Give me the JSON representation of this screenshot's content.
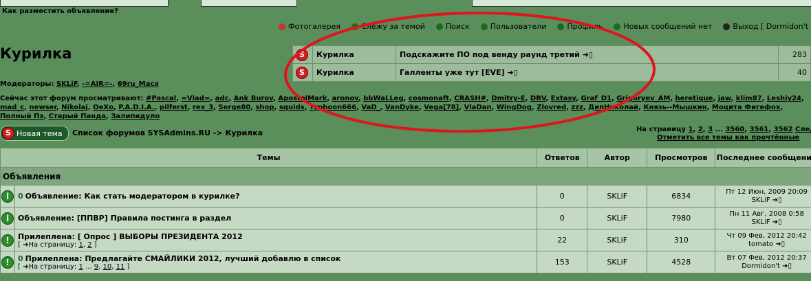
{
  "header": {
    "how_to_post": "Как разместить объявление?",
    "nav": [
      {
        "icon": "gallery-icon",
        "label": "Фотогалерея",
        "color": "#c0392b"
      },
      {
        "icon": "watch-icon",
        "label": "Слежу за темой",
        "color": "#1a6b1a"
      },
      {
        "icon": "search-icon",
        "label": "Поиск",
        "color": "#1a6b1a"
      },
      {
        "icon": "users-icon",
        "label": "Пользователи",
        "color": "#1a6b1a"
      },
      {
        "icon": "profile-icon",
        "label": "Профиль",
        "color": "#1a6b1a"
      },
      {
        "icon": "messages-icon",
        "label": "Новых сообщений нет",
        "color": "#1a6b1a"
      },
      {
        "icon": "logout-icon",
        "label": "Выход [ Dormidon't",
        "color": "#222222"
      }
    ]
  },
  "forum": {
    "title": "Курилка",
    "moderators_label": "Модераторы:",
    "moderators": [
      "SKLiF",
      "-=AIR=-",
      "69ru_Мася"
    ],
    "viewers_label": "Сейчас этот форум просматривают:",
    "viewers": [
      "#Pascal",
      "=Vlad=",
      "adc",
      "Ank Burov",
      "ApostolMark",
      "aronov",
      "bbWaLLeg",
      "cosmonaft",
      "CRASH#",
      "Dmitry-E",
      "DRV",
      "Extasy",
      "Graf_D1",
      "Grigoryev_AM",
      "heretique",
      "jaw",
      "klim87",
      "Leshiy24",
      "mad_c",
      "newser",
      "Nikolaj",
      "OeXo",
      "P.A.D.I.A.",
      "pilferst",
      "rex_3",
      "Serge80",
      "shop",
      "squids",
      "Typhoon666",
      "VaD_",
      "VanDyke",
      "Vega[78]",
      "VlaDan",
      "WingDog",
      "Zlovred",
      "zzz",
      "ДипНиколай",
      "Князь--Мышкин",
      "Моцита Фигефох",
      "Полный Пэ",
      "Старый Панда",
      "Залипидуло"
    ]
  },
  "popular": [
    {
      "forum": "Курилка",
      "topic": "Подскажите ПО под венду раунд третий",
      "count": "283"
    },
    {
      "forum": "Курилка",
      "topic": "Галленты уже тут [EVE]",
      "count": "40"
    }
  ],
  "toolbar": {
    "new_topic_label": "Новая тема",
    "breadcrumb": "Список форумов SYSAdmins.RU -> Курилка",
    "pager_label": "На страницу",
    "pages": [
      "1",
      "2",
      "3",
      "...",
      "3560",
      "3561",
      "3562"
    ],
    "next_label": "След.",
    "mark_read": "Отметить все темы как прочтённые"
  },
  "table": {
    "headers": {
      "topics": "Темы",
      "replies": "Ответов",
      "author": "Автор",
      "views": "Просмотров",
      "last": "Последнее сообщение"
    },
    "section": "Объявления",
    "rows": [
      {
        "prefix": "Объявление:",
        "title": "Как стать модератором в курилке?",
        "attachment": true,
        "pages_label": "",
        "pages": [],
        "replies": "0",
        "author": "SKLiF",
        "views": "6834",
        "last_date": "Пт 12 Июн, 2009 20:09",
        "last_user": "SKLiF"
      },
      {
        "prefix": "Объявление:",
        "title": "[ППВР] Правила постинга в раздел",
        "attachment": false,
        "pages_label": "",
        "pages": [],
        "replies": "0",
        "author": "SKLiF",
        "views": "7980",
        "last_date": "Пн 11 Авг, 2008 0:58",
        "last_user": "SKLiF"
      },
      {
        "prefix": "Прилеплена:",
        "title": "[ Опрос ] ВЫБОРЫ ПРЕЗИДЕНТА 2012",
        "attachment": false,
        "pages_label": "На страницу:",
        "pages": [
          "1",
          "2"
        ],
        "replies": "22",
        "author": "SKLiF",
        "views": "310",
        "last_date": "Чт 09 Фев, 2012 20:42",
        "last_user": "tomato"
      },
      {
        "prefix": "Прилеплена:",
        "title": "Предлагайте СМАЙЛИКИ 2012, лучший добавлю в список",
        "attachment": true,
        "pages_label": "На страницу:",
        "pages": [
          "1",
          "...",
          "9",
          "10",
          "11"
        ],
        "replies": "153",
        "author": "SKLiF",
        "views": "4528",
        "last_date": "Вт 07 Фев, 2012 20:37",
        "last_user": "Dormidon't"
      }
    ]
  },
  "annotation": {
    "color": "#e0141e"
  }
}
